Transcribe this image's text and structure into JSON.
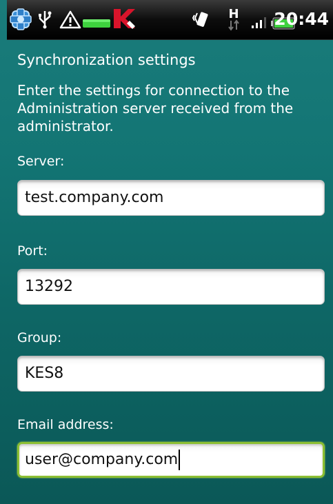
{
  "status_bar": {
    "time": "20:44",
    "icons": [
      "kaspersky-app-icon",
      "usb-icon",
      "warning-icon",
      "battery-green-icon",
      "kaspersky-k-icon",
      "vibrate-icon",
      "hspa-data-icon",
      "signal-icon",
      "battery-icon"
    ]
  },
  "screen": {
    "title": "Synchronization settings",
    "instructions": "Enter the settings for connection to the Administration server received from the administrator."
  },
  "fields": {
    "server": {
      "label": "Server:",
      "value": "test.company.com"
    },
    "port": {
      "label": "Port:",
      "value": "13292"
    },
    "group": {
      "label": "Group:",
      "value": "KES8"
    },
    "email": {
      "label": "Email address:",
      "value": "user@company.com",
      "focused": true
    }
  },
  "colors": {
    "background_top": "#1a7c7b",
    "background_bottom": "#0b5857",
    "focus_border": "#8cbf32",
    "status_bar": "#000000"
  }
}
